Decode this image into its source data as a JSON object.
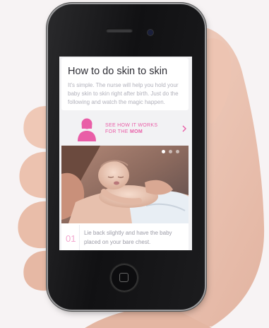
{
  "app": {
    "intro": {
      "title": "How to do skin to skin",
      "description": "It's simple. The nurse will help you hold your baby skin to skin right after birth. Just do the following and watch the magic happen."
    },
    "mom_link": {
      "line1": "SEE HOW IT WORKS",
      "line2_prefix": "FOR THE",
      "line2_emphasis": "MOM",
      "icon": "mother-silhouette-icon"
    },
    "carousel": {
      "page_count": 3,
      "active_page": 1
    },
    "step": {
      "number": "01",
      "text": "Lie back slightly and have the baby placed on your bare chest."
    }
  },
  "colors": {
    "accent_pink": "#e95ea7",
    "step_number_pink": "#f3a7cf",
    "title_text": "#2e2e35",
    "body_text": "#b0b0ba"
  }
}
